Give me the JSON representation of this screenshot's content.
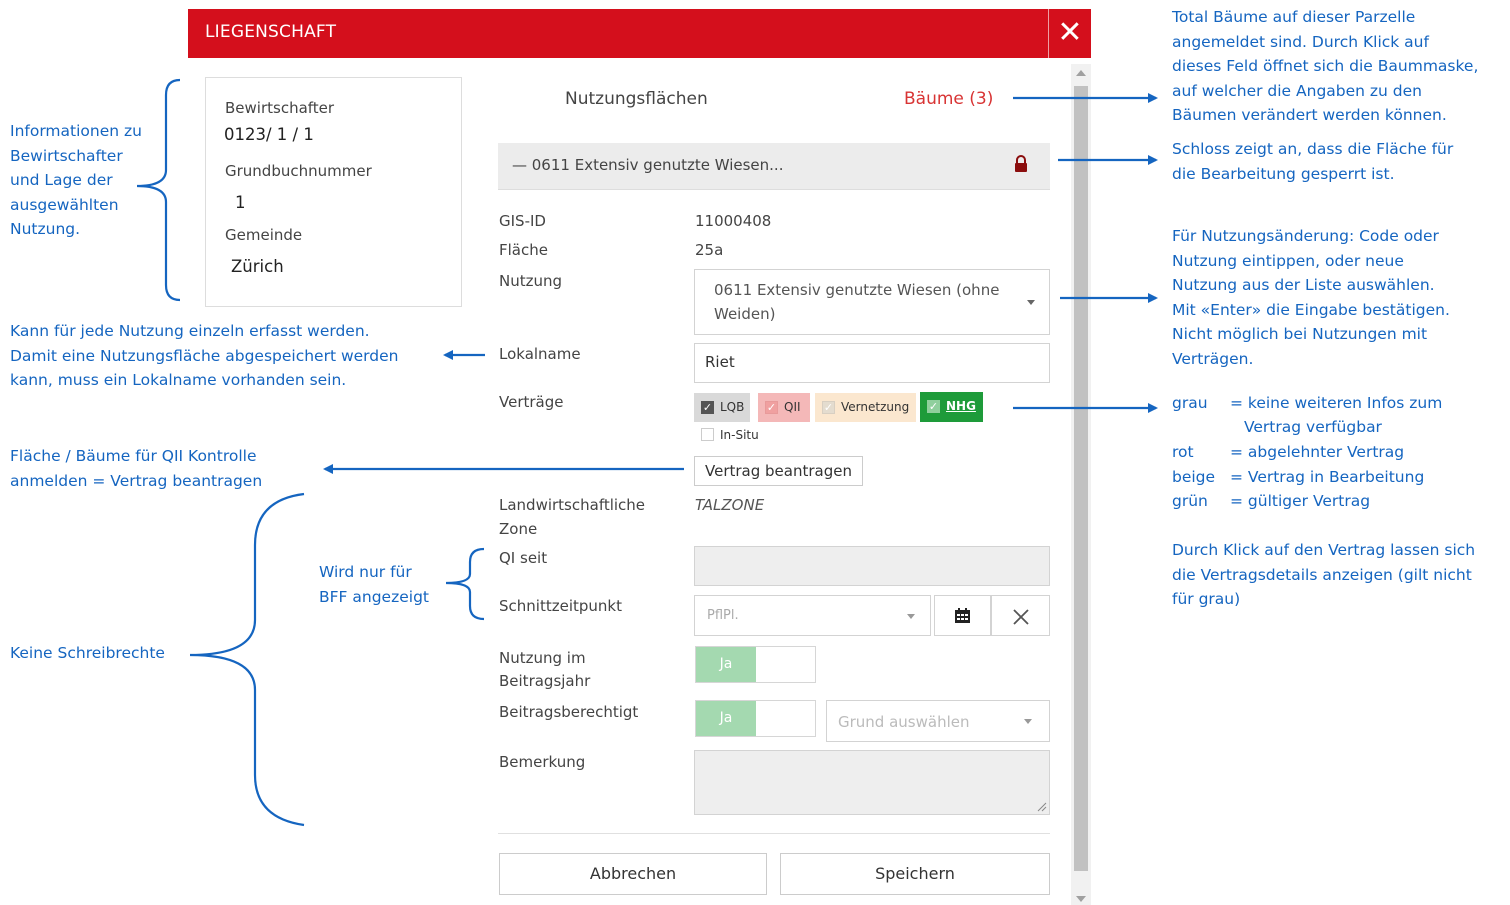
{
  "dialog": {
    "title": "LIEGENSCHAFT",
    "close_label": "✕",
    "info": {
      "bewirtschafter_label": "Bewirtschafter",
      "bewirtschafter_value": "0123/ 1 / 1",
      "grundbuch_label": "Grundbuchnummer",
      "grundbuch_value": "1",
      "gemeinde_label": "Gemeinde",
      "gemeinde_value": "Zürich"
    },
    "tab_title": "Nutzungsflächen",
    "baeume_link": "Bäume (3)",
    "accordion_title": "— 0611 Extensiv genutzte Wiesen...",
    "gis_label": "GIS-ID",
    "gis_value": "11000408",
    "flaeche_label": "Fläche",
    "flaeche_value": "25a",
    "nutzung_label": "Nutzung",
    "nutzung_value_line1": "0611 Extensiv genutzte Wiesen (ohne",
    "nutzung_value_line2": "Weiden)",
    "lokalname_label": "Lokalname",
    "lokalname_value": "Riet",
    "vertraege_label": "Verträge",
    "contracts": {
      "lqb": "LQB",
      "qii": "QII",
      "vernetzung": "Vernetzung",
      "nhg": "NHG",
      "insitu": "In-Situ"
    },
    "vertrag_button": "Vertrag beantragen",
    "zone_label_line1": "Landwirtschaftliche",
    "zone_label_line2": "Zone",
    "zone_value": "TALZONE",
    "qi_label": "QI seit",
    "schnitt_label": "Schnittzeitpunkt",
    "schnitt_value": "PflPl.",
    "nutzung_jahr_label_line1": "Nutzung im",
    "nutzung_jahr_label_line2": "Beitragsjahr",
    "toggle_on": "Ja",
    "beitrag_label": "Beitragsberechtigt",
    "grund_placeholder": "Grund auswählen",
    "bemerkung_label": "Bemerkung",
    "cancel_button": "Abbrechen",
    "save_button": "Speichern"
  },
  "annotations": {
    "info_lines": [
      "Informationen zu",
      "Bewirtschafter",
      "und Lage der",
      "ausgewählten",
      "Nutzung."
    ],
    "lokal_lines": [
      "Kann für jede Nutzung einzeln erfasst werden.",
      "Damit eine Nutzungsfläche abgespeichert werden",
      "kann, muss ein Lokalname vorhanden sein."
    ],
    "qii_lines": [
      "Fläche / Bäume für QII Kontrolle",
      "anmelden = Vertrag beantragen"
    ],
    "bff_lines": [
      "Wird nur für",
      "BFF angezeigt"
    ],
    "keine": "Keine Schreibrechte",
    "baeume_lines": [
      "Total Bäume auf dieser Parzelle",
      "angemeldet sind. Durch Klick auf",
      "dieses Feld öffnet sich die Baummaske,",
      "auf welcher die Angaben zu den",
      "Bäumen verändert werden können."
    ],
    "lock_lines": [
      "Schloss zeigt an, dass die Fläche für",
      "die Bearbeitung gesperrt ist."
    ],
    "nutzung_lines": [
      "Für Nutzungsänderung: Code oder",
      "Nutzung eintippen, oder neue",
      "Nutzung aus der Liste auswählen.",
      "Mit «Enter» die Eingabe bestätigen.",
      "Nicht möglich bei Nutzungen mit",
      "Verträgen."
    ],
    "legend": {
      "grau_key": "grau",
      "grau_val": "= keine weiteren Infos zum",
      "grau_val2": "Vertrag verfügbar",
      "rot_key": "rot",
      "rot_val": "= abgelehnter Vertrag",
      "beige_key": "beige",
      "beige_val": "= Vertrag in Bearbeitung",
      "gruen_key": "grün",
      "gruen_val": "= gültiger Vertrag"
    },
    "klick_lines": [
      "Durch Klick auf den Vertrag lassen sich",
      "die Vertragsdetails anzeigen (gilt nicht",
      "für grau)"
    ]
  },
  "colors": {
    "header": "#d40f1c",
    "annotation": "#1565c0",
    "contract_grey": "#d9d9d9",
    "contract_red": "#f4b8b8",
    "contract_beige": "#fbe7cf",
    "contract_green": "#1e9b3a"
  }
}
